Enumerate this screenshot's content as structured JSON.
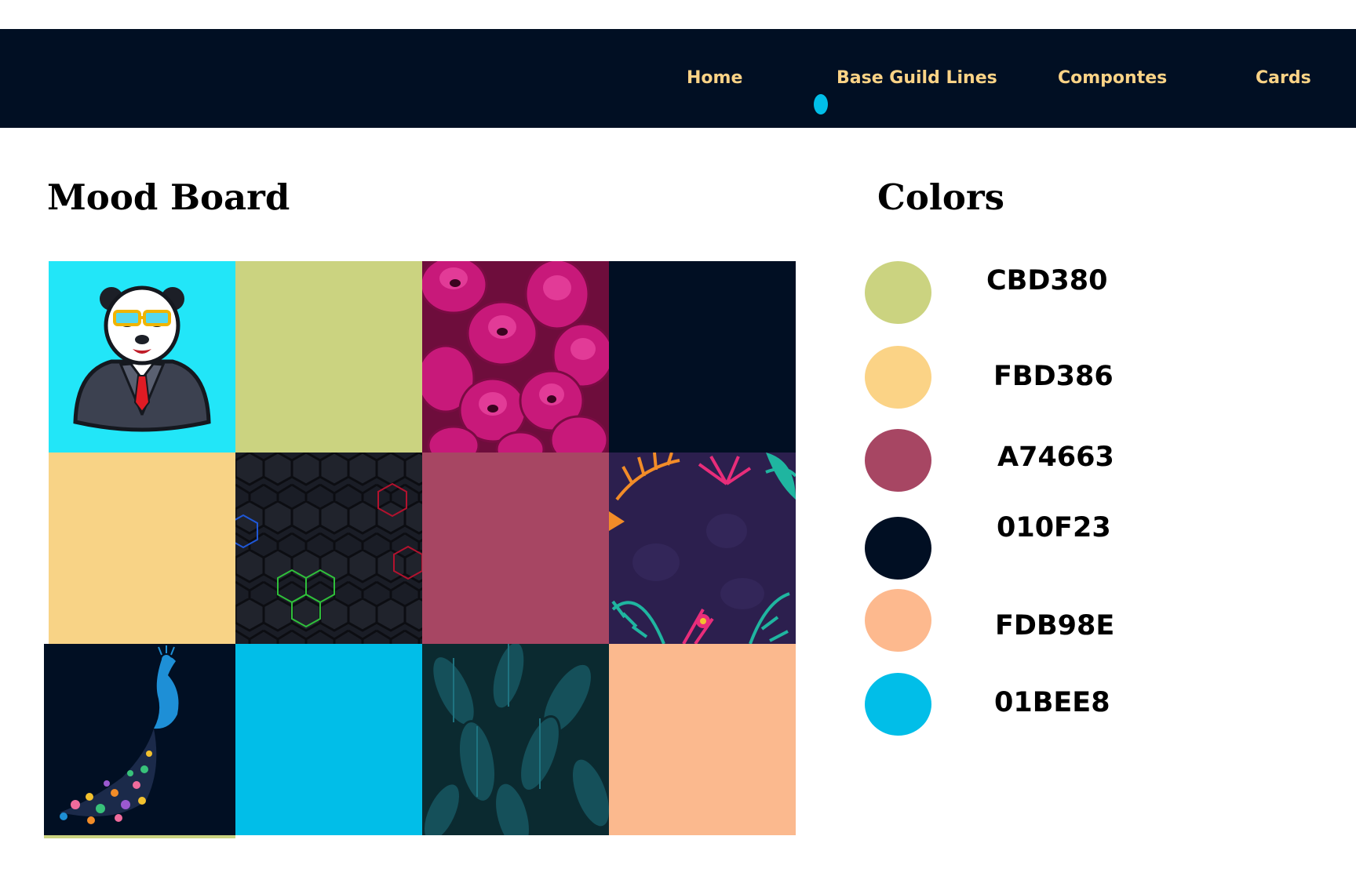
{
  "nav": {
    "items": [
      {
        "label": "Home"
      },
      {
        "label": "Base Guild Lines"
      },
      {
        "label": "Compontes"
      },
      {
        "label": "Cards"
      }
    ]
  },
  "mood_board": {
    "title": "Mood Board",
    "tiles": [
      {
        "kind": "image",
        "icon": "panda-mascot-icon",
        "color": "#22e6f8"
      },
      {
        "kind": "color",
        "color": "#cbd380"
      },
      {
        "kind": "image",
        "icon": "pink-tulips-photo",
        "color": "#c8197a"
      },
      {
        "kind": "color",
        "color": "#010f23"
      },
      {
        "kind": "color",
        "color": "#f8d386"
      },
      {
        "kind": "image",
        "icon": "hexagon-pattern-icon",
        "color": "#1a1d26"
      },
      {
        "kind": "color",
        "color": "#a74663"
      },
      {
        "kind": "image",
        "icon": "tropical-leaves-frame-icon",
        "color": "#2c1f4e"
      },
      {
        "kind": "image",
        "icon": "peacock-icon",
        "color": "#010f23"
      },
      {
        "kind": "color",
        "color": "#01bee8"
      },
      {
        "kind": "image",
        "icon": "dark-feathers-photo",
        "color": "#0b2a30"
      },
      {
        "kind": "color",
        "color": "#fbb98e"
      }
    ]
  },
  "colors": {
    "title": "Colors",
    "swatches": [
      {
        "hex": "CBD380",
        "color": "#cbd380"
      },
      {
        "hex": "FBD386",
        "color": "#fbd386"
      },
      {
        "hex": "A74663",
        "color": "#a74663"
      },
      {
        "hex": "010F23",
        "color": "#010f23"
      },
      {
        "hex": "FDB98E",
        "color": "#fdb98e"
      },
      {
        "hex": "01BEE8",
        "color": "#01bee8"
      }
    ]
  },
  "theme": {
    "nav_background": "#010f23",
    "nav_text": "#fbd386",
    "accent": "#01bee8"
  }
}
